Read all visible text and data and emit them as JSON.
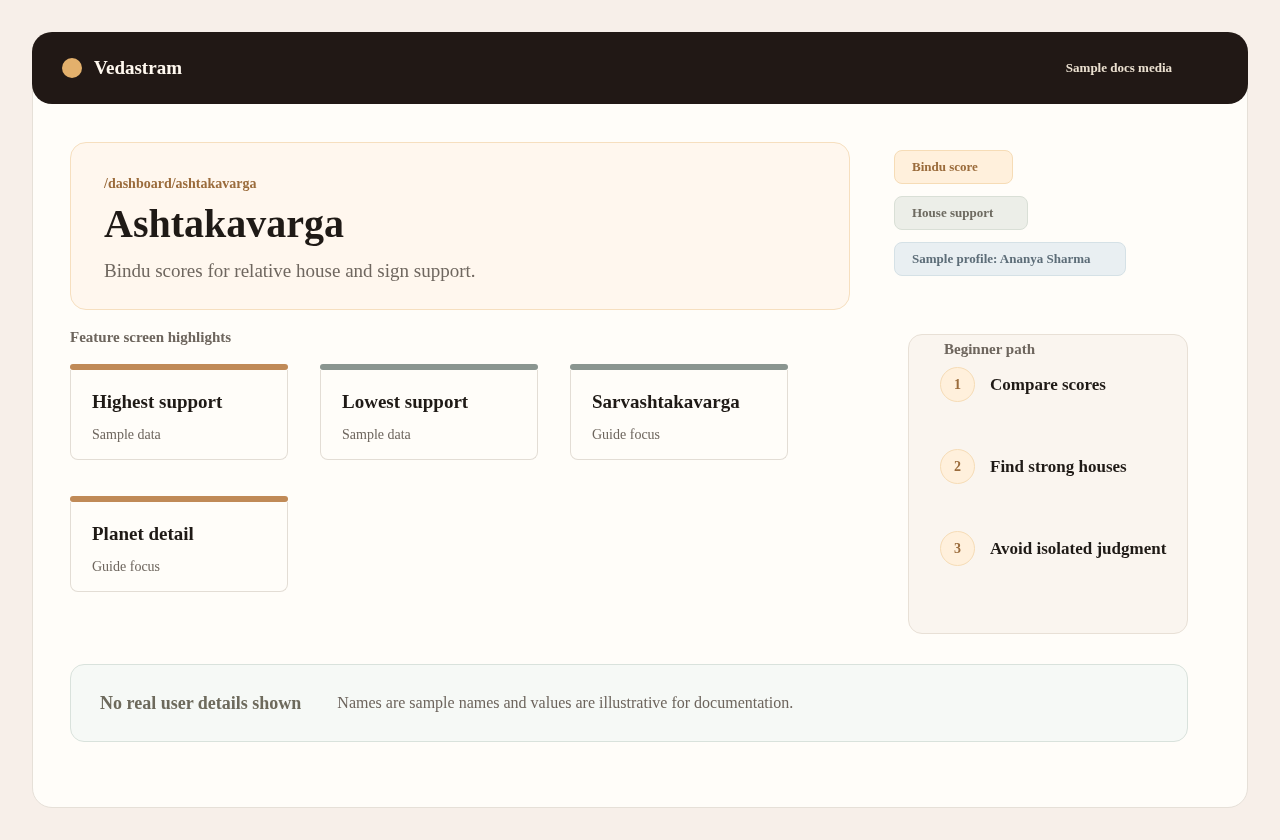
{
  "header": {
    "brand": "Vedastram",
    "link": "Sample docs media"
  },
  "hero": {
    "breadcrumb": "/dashboard/ashtakavarga",
    "title": "Ashtakavarga",
    "subtitle": "Bindu scores for relative house and sign support."
  },
  "tags": [
    {
      "label": "Bindu score",
      "kind": "accent"
    },
    {
      "label": "House support",
      "kind": "neutral"
    },
    {
      "label": "Sample profile: Ananya Sharma",
      "kind": "info"
    }
  ],
  "highlights": {
    "heading": "Feature screen highlights",
    "cards": [
      {
        "title": "Highest support",
        "subtitle": "Sample data",
        "color": "#c08a57"
      },
      {
        "title": "Lowest support",
        "subtitle": "Sample data",
        "color": "#8a9590"
      },
      {
        "title": "Sarvashtakavarga",
        "subtitle": "Guide focus",
        "color": "#8a9590"
      },
      {
        "title": "Planet detail",
        "subtitle": "Guide focus",
        "color": "#c08a57"
      }
    ]
  },
  "beginner_path": {
    "title": "Beginner path",
    "steps": [
      {
        "number": "1",
        "label": "Compare scores"
      },
      {
        "number": "2",
        "label": "Find strong houses"
      },
      {
        "number": "3",
        "label": "Avoid isolated judgment"
      }
    ]
  },
  "notice": {
    "title": "No real user details shown",
    "text": "Names are sample names and values are illustrative for documentation."
  }
}
